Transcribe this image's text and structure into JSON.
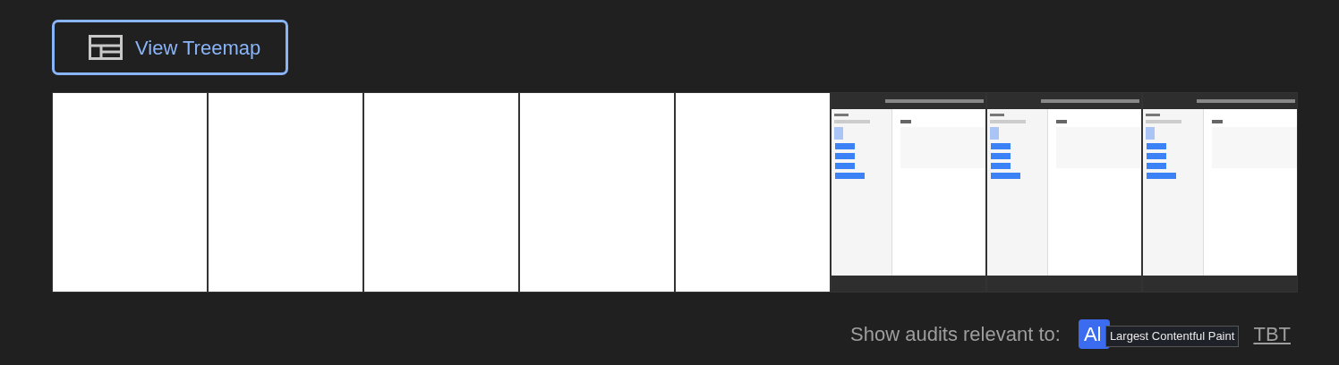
{
  "treemap_button": {
    "label": "View Treemap"
  },
  "filmstrip": [
    {
      "kind": "blank"
    },
    {
      "kind": "blank"
    },
    {
      "kind": "blank"
    },
    {
      "kind": "blank"
    },
    {
      "kind": "blank"
    },
    {
      "kind": "picture"
    },
    {
      "kind": "picture"
    },
    {
      "kind": "picture"
    }
  ],
  "audit_filter": {
    "label": "Show audits relevant to:",
    "options": [
      {
        "label": "Al",
        "selected": true
      },
      {
        "label": "TBT",
        "selected": false
      }
    ],
    "tooltip": "Largest Contentful Paint"
  }
}
